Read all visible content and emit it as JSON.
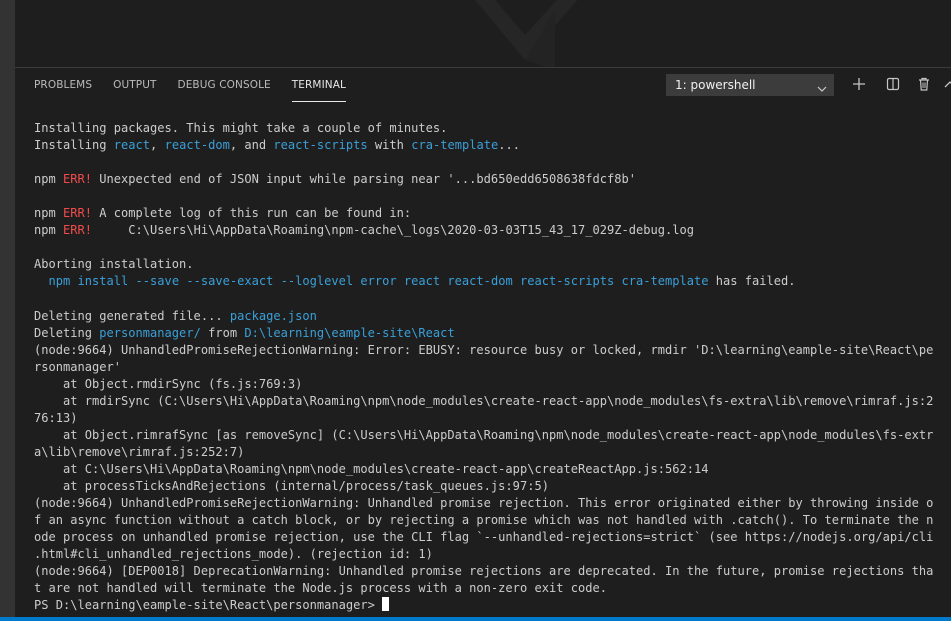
{
  "panel": {
    "tabs": [
      {
        "label": "PROBLEMS"
      },
      {
        "label": "OUTPUT"
      },
      {
        "label": "DEBUG CONSOLE"
      },
      {
        "label": "TERMINAL",
        "active": true
      }
    ],
    "terminal_select": "1: powershell",
    "actions": [
      "plus-icon",
      "split-icon",
      "trash-icon",
      "chevron-up-icon"
    ]
  },
  "colors": {
    "background": "#1e1e1e",
    "text": "#cccccc",
    "link": "#3a9fd8",
    "error": "#f14c4c",
    "statusbar": "#007acc"
  },
  "terminal_lines": [
    [
      {
        "t": "Installing packages. This might take a couple of minutes."
      }
    ],
    [
      {
        "t": "Installing "
      },
      {
        "t": "react",
        "c": "cyan"
      },
      {
        "t": ", "
      },
      {
        "t": "react-dom",
        "c": "cyan"
      },
      {
        "t": ", and "
      },
      {
        "t": "react-scripts",
        "c": "cyan"
      },
      {
        "t": " with "
      },
      {
        "t": "cra-template",
        "c": "cyan"
      },
      {
        "t": "..."
      }
    ],
    [],
    [
      {
        "t": "npm "
      },
      {
        "t": "ERR!",
        "c": "red"
      },
      {
        "t": " Unexpected end of JSON input while parsing near '...bd650edd6508638fdcf8b'"
      }
    ],
    [],
    [
      {
        "t": "npm "
      },
      {
        "t": "ERR!",
        "c": "red"
      },
      {
        "t": " A complete log of this run can be found in:"
      }
    ],
    [
      {
        "t": "npm "
      },
      {
        "t": "ERR!",
        "c": "red"
      },
      {
        "t": "     C:\\Users\\Hi\\AppData\\Roaming\\npm-cache\\_logs\\2020-03-03T15_43_17_029Z-debug.log"
      }
    ],
    [],
    [
      {
        "t": "Aborting installation."
      }
    ],
    [
      {
        "t": "  "
      },
      {
        "t": "npm install --save --save-exact --loglevel error react react-dom react-scripts cra-template",
        "c": "cyan"
      },
      {
        "t": " has failed."
      }
    ],
    [],
    [
      {
        "t": "Deleting generated file... "
      },
      {
        "t": "package.json",
        "c": "cyan"
      }
    ],
    [
      {
        "t": "Deleting "
      },
      {
        "t": "personmanager/",
        "c": "cyan"
      },
      {
        "t": " from "
      },
      {
        "t": "D:\\learning\\eample-site\\React",
        "c": "cyan"
      }
    ],
    [
      {
        "t": "(node:9664) UnhandledPromiseRejectionWarning: Error: EBUSY: resource busy or locked, rmdir 'D:\\learning\\eample-site\\React\\pe"
      }
    ],
    [
      {
        "t": "rsonmanager'"
      }
    ],
    [
      {
        "t": "    at Object.rmdirSync (fs.js:769:3)"
      }
    ],
    [
      {
        "t": "    at rmdirSync (C:\\Users\\Hi\\AppData\\Roaming\\npm\\node_modules\\create-react-app\\node_modules\\fs-extra\\lib\\remove\\rimraf.js:2"
      }
    ],
    [
      {
        "t": "76:13)"
      }
    ],
    [
      {
        "t": "    at Object.rimrafSync [as removeSync] (C:\\Users\\Hi\\AppData\\Roaming\\npm\\node_modules\\create-react-app\\node_modules\\fs-extr"
      }
    ],
    [
      {
        "t": "a\\lib\\remove\\rimraf.js:252:7)"
      }
    ],
    [
      {
        "t": "    at C:\\Users\\Hi\\AppData\\Roaming\\npm\\node_modules\\create-react-app\\createReactApp.js:562:14"
      }
    ],
    [
      {
        "t": "    at processTicksAndRejections (internal/process/task_queues.js:97:5)"
      }
    ],
    [
      {
        "t": "(node:9664) UnhandledPromiseRejectionWarning: Unhandled promise rejection. This error originated either by throwing inside o"
      }
    ],
    [
      {
        "t": "f an async function without a catch block, or by rejecting a promise which was not handled with .catch(). To terminate the n"
      }
    ],
    [
      {
        "t": "ode process on unhandled promise rejection, use the CLI flag `--unhandled-rejections=strict` (see https://nodejs.org/api/cli"
      }
    ],
    [
      {
        "t": ".html#cli_unhandled_rejections_mode). (rejection id: 1)"
      }
    ],
    [
      {
        "t": "(node:9664) [DEP0018] DeprecationWarning: Unhandled promise rejections are deprecated. In the future, promise rejections tha"
      }
    ],
    [
      {
        "t": "t are not handled will terminate the Node.js process with a non-zero exit code."
      }
    ],
    [
      {
        "t": "PS D:\\learning\\eample-site\\React\\personmanager> "
      }
    ]
  ]
}
